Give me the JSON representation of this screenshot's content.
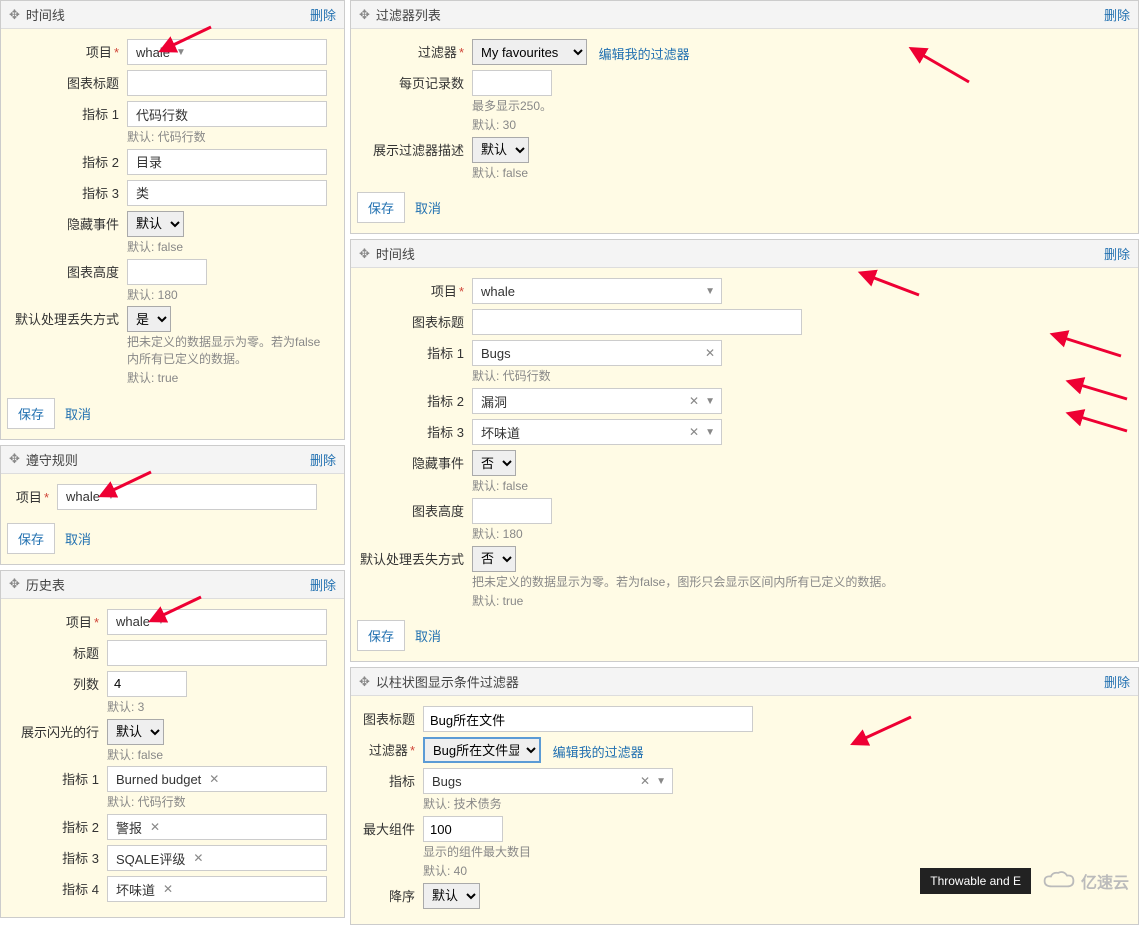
{
  "common": {
    "delete": "删除",
    "save": "保存",
    "cancel": "取消",
    "project_label": "项目",
    "chart_title_label": "图表标题",
    "default_prefix": "默认:"
  },
  "timeline1": {
    "title": "时间线",
    "project_value": "whale",
    "metric1_label": "指标 1",
    "metric1_value": "代码行数",
    "metric1_default": "默认: 代码行数",
    "metric2_label": "指标 2",
    "metric2_value": "目录",
    "metric3_label": "指标 3",
    "metric3_value": "类",
    "hide_events_label": "隐藏事件",
    "hide_events_value": "默认",
    "hide_events_default": "默认: false",
    "chart_height_label": "图表高度",
    "chart_height_default": "默认: 180",
    "missing_label": "默认处理丢失方式",
    "missing_value": "是",
    "missing_help": "把未定义的数据显示为零。若为false内所有已定义的数据。",
    "missing_default": "默认: true"
  },
  "rules": {
    "title": "遵守规则",
    "project_value": "whale"
  },
  "history": {
    "title": "历史表",
    "project_value": "whale",
    "title_label": "标题",
    "cols_label": "列数",
    "cols_value": "4",
    "cols_default": "默认: 3",
    "flash_label": "展示闪光的行",
    "flash_value": "默认",
    "flash_default": "默认: false",
    "metric1_label": "指标 1",
    "metric1_value": "Burned budget",
    "metric1_default": "默认: 代码行数",
    "metric2_label": "指标 2",
    "metric2_value": "警报",
    "metric3_label": "指标 3",
    "metric3_value": "SQALE评级",
    "metric4_label": "指标 4",
    "metric4_value": "坏味道"
  },
  "filter_list": {
    "title": "过滤器列表",
    "filter_label": "过滤器",
    "filter_value": "My favourites",
    "edit_link": "编辑我的过滤器",
    "page_size_label": "每页记录数",
    "page_size_help": "最多显示250。",
    "page_size_default": "默认: 30",
    "show_desc_label": "展示过滤器描述",
    "show_desc_value": "默认",
    "show_desc_default": "默认: false"
  },
  "timeline2": {
    "title": "时间线",
    "project_value": "whale",
    "metric1_label": "指标 1",
    "metric1_value": "Bugs",
    "metric1_default": "默认: 代码行数",
    "metric2_label": "指标 2",
    "metric2_value": "漏洞",
    "metric3_label": "指标 3",
    "metric3_value": "坏味道",
    "hide_events_label": "隐藏事件",
    "hide_events_value": "否",
    "hide_events_default": "默认: false",
    "chart_height_label": "图表高度",
    "chart_height_default": "默认: 180",
    "missing_label": "默认处理丢失方式",
    "missing_value": "否",
    "missing_help": "把未定义的数据显示为零。若为false，图形只会显示区间内所有已定义的数据。",
    "missing_default": "默认: true"
  },
  "barchart": {
    "title": "以柱状图显示条件过滤器",
    "chart_title_value": "Bug所在文件",
    "filter_label": "过滤器",
    "filter_value": "Bug所在文件显示",
    "edit_link": "编辑我的过滤器",
    "metric_label": "指标",
    "metric_value": "Bugs",
    "metric_default": "默认: 技术债务",
    "max_comp_label": "最大组件",
    "max_comp_value": "100",
    "max_comp_help": "显示的组件最大数目",
    "max_comp_default": "默认: 40",
    "desc_label": "降序",
    "desc_value": "默认"
  },
  "footer": {
    "status": "Throwable and E",
    "watermark": "亿速云"
  }
}
